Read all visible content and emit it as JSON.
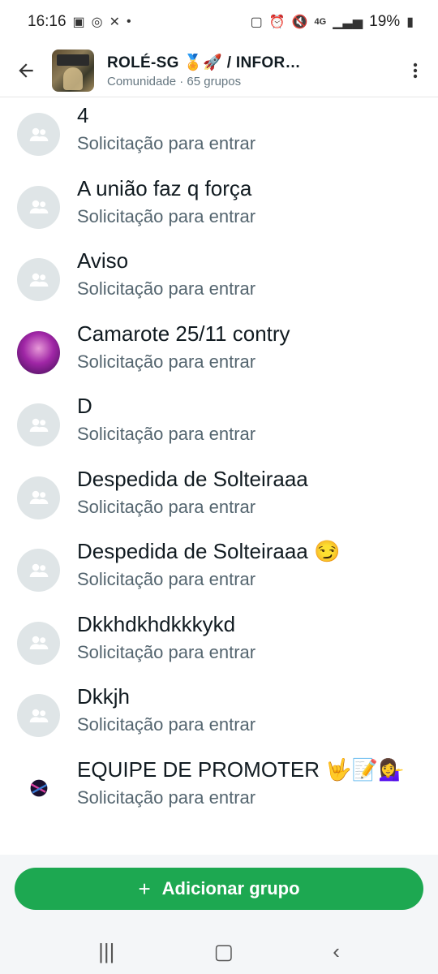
{
  "status_bar": {
    "time": "16:16",
    "dot": "•",
    "network": "4G",
    "battery": "19%"
  },
  "header": {
    "title": "ROLÉ-SG 🏅🚀 / INFOR…",
    "subtitle": "Comunidade · 65 grupos",
    "back_icon": "arrow-left-icon",
    "menu_icon": "more-vertical-icon"
  },
  "groups": [
    {
      "name": "4",
      "status": "Solicitação para entrar",
      "avatar": "group-default"
    },
    {
      "name": "A união faz q força",
      "status": "Solicitação para entrar",
      "avatar": "group-default"
    },
    {
      "name": "Aviso",
      "status": "Solicitação para entrar",
      "avatar": "group-default"
    },
    {
      "name": "Camarote 25/11 contry",
      "status": "Solicitação para entrar",
      "avatar": "photo"
    },
    {
      "name": "D",
      "status": "Solicitação para entrar",
      "avatar": "group-default"
    },
    {
      "name": "Despedida de Solteiraaa",
      "status": "Solicitação para entrar",
      "avatar": "group-default"
    },
    {
      "name": "Despedida de Solteiraaa 😏",
      "status": "Solicitação para entrar",
      "avatar": "group-default"
    },
    {
      "name": "Dkkhdkhdkkkykd",
      "status": "Solicitação para entrar",
      "avatar": "group-default"
    },
    {
      "name": "Dkkjh",
      "status": "Solicitação para entrar",
      "avatar": "group-default"
    },
    {
      "name": "EQUIPE DE PROMOTER 🤟📝💁‍♀️",
      "status": "Solicitação para entrar",
      "avatar": "photo"
    }
  ],
  "footer": {
    "add_label": "Adicionar grupo",
    "plus": "+"
  },
  "colors": {
    "accent": "#1da851",
    "avatar_bg": "#dfe5e7"
  }
}
